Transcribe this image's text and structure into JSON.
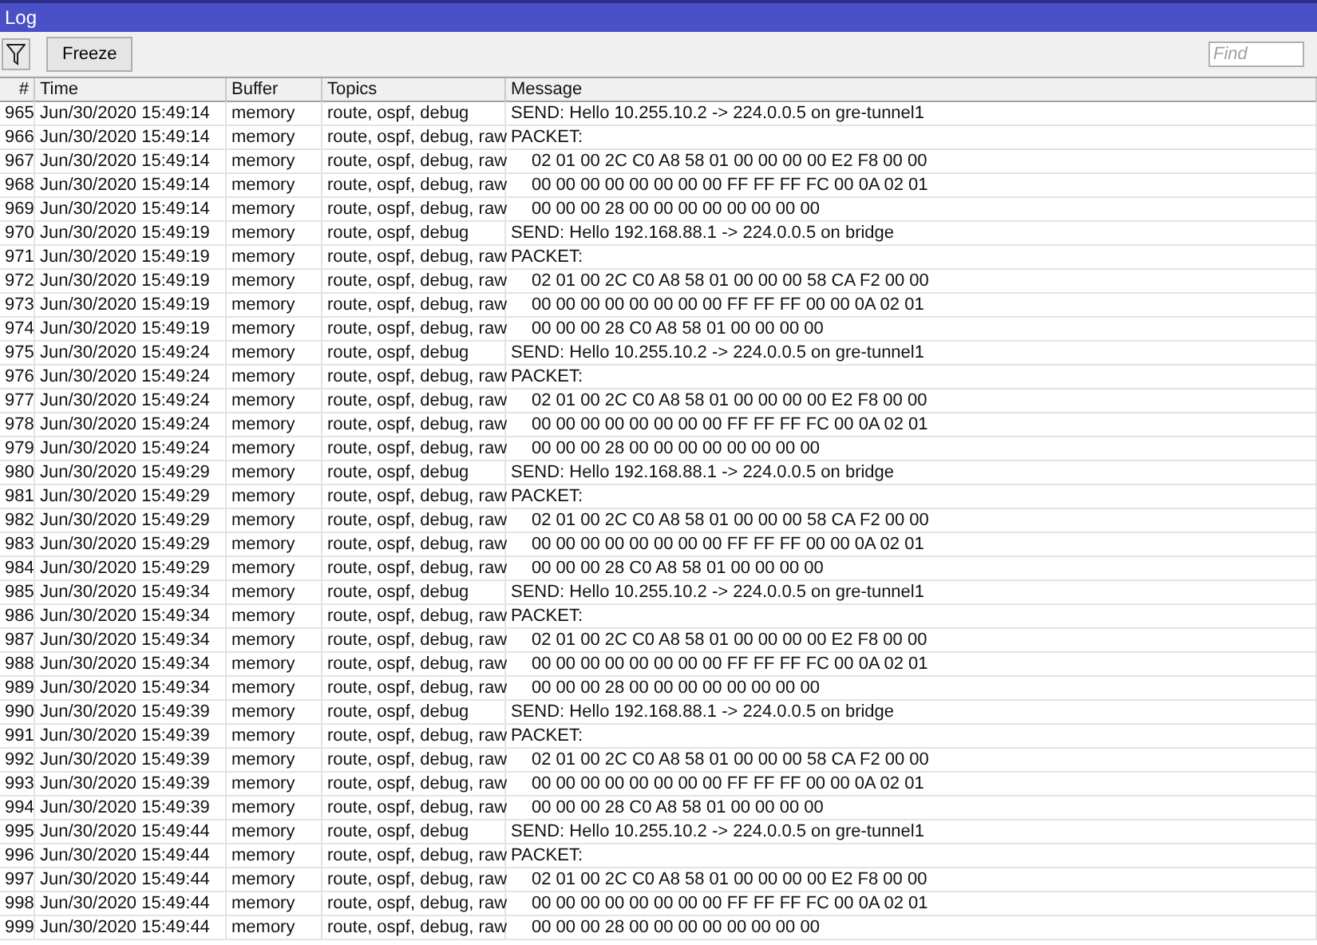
{
  "window": {
    "title": "Log"
  },
  "toolbar": {
    "freeze_button": "Freeze",
    "find": {
      "placeholder": "Find"
    }
  },
  "table": {
    "columns": [
      "#",
      "Time",
      "Buffer",
      "Topics",
      "Message"
    ],
    "rows": [
      {
        "kind": "text",
        "cells": [
          "965",
          "Jun/30/2020 15:49:14",
          "memory",
          "route, ospf, debug",
          "SEND: Hello 10.255.10.2 -> 224.0.0.5 on gre-tunnel1"
        ]
      },
      {
        "kind": "text",
        "cells": [
          "966",
          "Jun/30/2020 15:49:14",
          "memory",
          "route, ospf, debug, raw",
          "PACKET:"
        ]
      },
      {
        "kind": "hex",
        "cells": [
          "967",
          "Jun/30/2020 15:49:14",
          "memory",
          "route, ospf, debug, raw",
          "02 01 00 2C C0 A8 58 01 00 00 00 00 E2 F8 00 00"
        ]
      },
      {
        "kind": "hex",
        "cells": [
          "968",
          "Jun/30/2020 15:49:14",
          "memory",
          "route, ospf, debug, raw",
          "00 00 00 00 00 00 00 00 FF FF FF FC 00 0A 02 01"
        ]
      },
      {
        "kind": "hex",
        "cells": [
          "969",
          "Jun/30/2020 15:49:14",
          "memory",
          "route, ospf, debug, raw",
          "00 00 00 28 00 00 00 00 00 00 00 00"
        ]
      },
      {
        "kind": "text",
        "cells": [
          "970",
          "Jun/30/2020 15:49:19",
          "memory",
          "route, ospf, debug",
          "SEND: Hello 192.168.88.1 -> 224.0.0.5 on bridge"
        ]
      },
      {
        "kind": "text",
        "cells": [
          "971",
          "Jun/30/2020 15:49:19",
          "memory",
          "route, ospf, debug, raw",
          "PACKET:"
        ]
      },
      {
        "kind": "hex",
        "cells": [
          "972",
          "Jun/30/2020 15:49:19",
          "memory",
          "route, ospf, debug, raw",
          "02 01 00 2C C0 A8 58 01 00 00 00 58 CA F2 00 00"
        ]
      },
      {
        "kind": "hex",
        "cells": [
          "973",
          "Jun/30/2020 15:49:19",
          "memory",
          "route, ospf, debug, raw",
          "00 00 00 00 00 00 00 00 FF FF FF 00 00 0A 02 01"
        ]
      },
      {
        "kind": "hex",
        "cells": [
          "974",
          "Jun/30/2020 15:49:19",
          "memory",
          "route, ospf, debug, raw",
          "00 00 00 28 C0 A8 58 01 00 00 00 00"
        ]
      },
      {
        "kind": "text",
        "cells": [
          "975",
          "Jun/30/2020 15:49:24",
          "memory",
          "route, ospf, debug",
          "SEND: Hello 10.255.10.2 -> 224.0.0.5 on gre-tunnel1"
        ]
      },
      {
        "kind": "text",
        "cells": [
          "976",
          "Jun/30/2020 15:49:24",
          "memory",
          "route, ospf, debug, raw",
          "PACKET:"
        ]
      },
      {
        "kind": "hex",
        "cells": [
          "977",
          "Jun/30/2020 15:49:24",
          "memory",
          "route, ospf, debug, raw",
          "02 01 00 2C C0 A8 58 01 00 00 00 00 E2 F8 00 00"
        ]
      },
      {
        "kind": "hex",
        "cells": [
          "978",
          "Jun/30/2020 15:49:24",
          "memory",
          "route, ospf, debug, raw",
          "00 00 00 00 00 00 00 00 FF FF FF FC 00 0A 02 01"
        ]
      },
      {
        "kind": "hex",
        "cells": [
          "979",
          "Jun/30/2020 15:49:24",
          "memory",
          "route, ospf, debug, raw",
          "00 00 00 28 00 00 00 00 00 00 00 00"
        ]
      },
      {
        "kind": "text",
        "cells": [
          "980",
          "Jun/30/2020 15:49:29",
          "memory",
          "route, ospf, debug",
          "SEND: Hello 192.168.88.1 -> 224.0.0.5 on bridge"
        ]
      },
      {
        "kind": "text",
        "cells": [
          "981",
          "Jun/30/2020 15:49:29",
          "memory",
          "route, ospf, debug, raw",
          "PACKET:"
        ]
      },
      {
        "kind": "hex",
        "cells": [
          "982",
          "Jun/30/2020 15:49:29",
          "memory",
          "route, ospf, debug, raw",
          "02 01 00 2C C0 A8 58 01 00 00 00 58 CA F2 00 00"
        ]
      },
      {
        "kind": "hex",
        "cells": [
          "983",
          "Jun/30/2020 15:49:29",
          "memory",
          "route, ospf, debug, raw",
          "00 00 00 00 00 00 00 00 FF FF FF 00 00 0A 02 01"
        ]
      },
      {
        "kind": "hex",
        "cells": [
          "984",
          "Jun/30/2020 15:49:29",
          "memory",
          "route, ospf, debug, raw",
          "00 00 00 28 C0 A8 58 01 00 00 00 00"
        ]
      },
      {
        "kind": "text",
        "cells": [
          "985",
          "Jun/30/2020 15:49:34",
          "memory",
          "route, ospf, debug",
          "SEND: Hello 10.255.10.2 -> 224.0.0.5 on gre-tunnel1"
        ]
      },
      {
        "kind": "text",
        "cells": [
          "986",
          "Jun/30/2020 15:49:34",
          "memory",
          "route, ospf, debug, raw",
          "PACKET:"
        ]
      },
      {
        "kind": "hex",
        "cells": [
          "987",
          "Jun/30/2020 15:49:34",
          "memory",
          "route, ospf, debug, raw",
          "02 01 00 2C C0 A8 58 01 00 00 00 00 E2 F8 00 00"
        ]
      },
      {
        "kind": "hex",
        "cells": [
          "988",
          "Jun/30/2020 15:49:34",
          "memory",
          "route, ospf, debug, raw",
          "00 00 00 00 00 00 00 00 FF FF FF FC 00 0A 02 01"
        ]
      },
      {
        "kind": "hex",
        "cells": [
          "989",
          "Jun/30/2020 15:49:34",
          "memory",
          "route, ospf, debug, raw",
          "00 00 00 28 00 00 00 00 00 00 00 00"
        ]
      },
      {
        "kind": "text",
        "cells": [
          "990",
          "Jun/30/2020 15:49:39",
          "memory",
          "route, ospf, debug",
          "SEND: Hello 192.168.88.1 -> 224.0.0.5 on bridge"
        ]
      },
      {
        "kind": "text",
        "cells": [
          "991",
          "Jun/30/2020 15:49:39",
          "memory",
          "route, ospf, debug, raw",
          "PACKET:"
        ]
      },
      {
        "kind": "hex",
        "cells": [
          "992",
          "Jun/30/2020 15:49:39",
          "memory",
          "route, ospf, debug, raw",
          "02 01 00 2C C0 A8 58 01 00 00 00 58 CA F2 00 00"
        ]
      },
      {
        "kind": "hex",
        "cells": [
          "993",
          "Jun/30/2020 15:49:39",
          "memory",
          "route, ospf, debug, raw",
          "00 00 00 00 00 00 00 00 FF FF FF 00 00 0A 02 01"
        ]
      },
      {
        "kind": "hex",
        "cells": [
          "994",
          "Jun/30/2020 15:49:39",
          "memory",
          "route, ospf, debug, raw",
          "00 00 00 28 C0 A8 58 01 00 00 00 00"
        ]
      },
      {
        "kind": "text",
        "cells": [
          "995",
          "Jun/30/2020 15:49:44",
          "memory",
          "route, ospf, debug",
          "SEND: Hello 10.255.10.2 -> 224.0.0.5 on gre-tunnel1"
        ]
      },
      {
        "kind": "text",
        "cells": [
          "996",
          "Jun/30/2020 15:49:44",
          "memory",
          "route, ospf, debug, raw",
          "PACKET:"
        ]
      },
      {
        "kind": "hex",
        "cells": [
          "997",
          "Jun/30/2020 15:49:44",
          "memory",
          "route, ospf, debug, raw",
          "02 01 00 2C C0 A8 58 01 00 00 00 00 E2 F8 00 00"
        ]
      },
      {
        "kind": "hex",
        "cells": [
          "998",
          "Jun/30/2020 15:49:44",
          "memory",
          "route, ospf, debug, raw",
          "00 00 00 00 00 00 00 00 FF FF FF FC 00 0A 02 01"
        ]
      },
      {
        "kind": "hex",
        "cells": [
          "999",
          "Jun/30/2020 15:49:44",
          "memory",
          "route, ospf, debug, raw",
          "00 00 00 28 00 00 00 00 00 00 00 00"
        ]
      }
    ]
  }
}
